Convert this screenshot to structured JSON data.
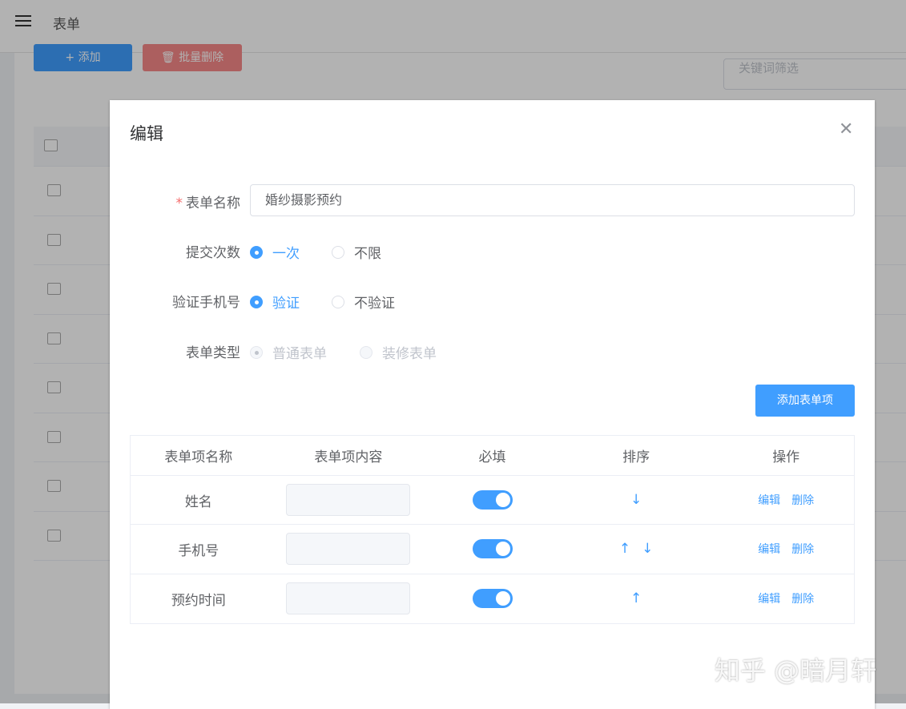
{
  "header": {
    "title": "表单"
  },
  "toolbar": {
    "add_label": "+ 添加",
    "batch_delete_label": "🗑 批量删除",
    "search_placeholder": "关键词筛选"
  },
  "modal": {
    "title": "编辑",
    "fields": {
      "name_label": "表单名称",
      "name_value": "婚纱摄影预约",
      "submit_label": "提交次数",
      "submit_options": [
        "一次",
        "不限"
      ],
      "verify_label": "验证手机号",
      "verify_options": [
        "验证",
        "不验证"
      ],
      "type_label": "表单类型",
      "type_options": [
        "普通表单",
        "装修表单"
      ]
    },
    "add_item_label": "添加表单项",
    "table": {
      "headers": [
        "表单项名称",
        "表单项内容",
        "必填",
        "排序",
        "操作"
      ],
      "rows": [
        {
          "name": "姓名",
          "required": true,
          "sort": [
            "↓"
          ]
        },
        {
          "name": "手机号",
          "required": true,
          "sort": [
            "↑",
            "↓"
          ]
        },
        {
          "name": "预约时间",
          "required": true,
          "sort": [
            "↑"
          ]
        }
      ],
      "edit_label": "编辑",
      "delete_label": "删除"
    }
  },
  "watermark": "知乎 @暗月轩",
  "colors": {
    "primary": "#409eff",
    "danger": "#f56c6c"
  }
}
